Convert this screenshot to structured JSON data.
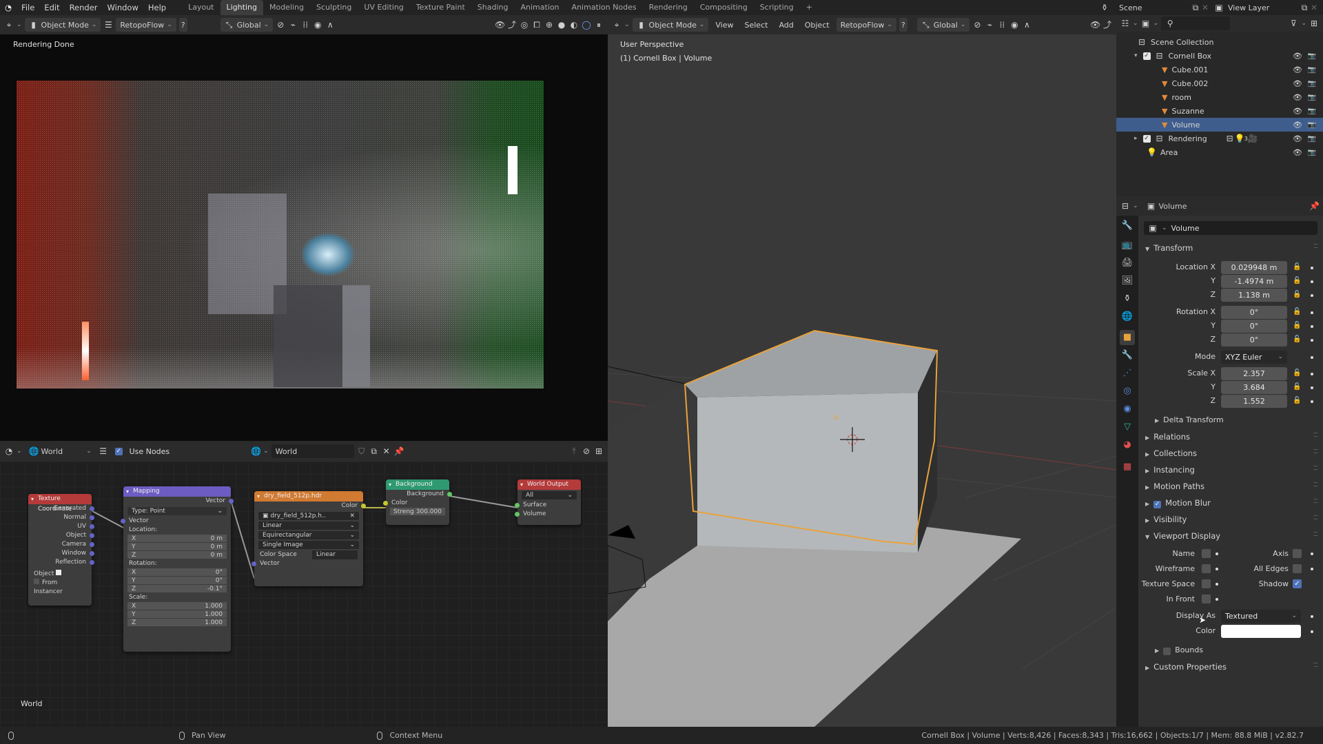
{
  "app": {
    "logo_icon": "blender-logo-icon"
  },
  "menu": [
    "File",
    "Edit",
    "Render",
    "Window",
    "Help"
  ],
  "workspaces": [
    {
      "label": "Layout",
      "active": false
    },
    {
      "label": "Lighting",
      "active": true
    },
    {
      "label": "Modeling",
      "active": false
    },
    {
      "label": "Sculpting",
      "active": false
    },
    {
      "label": "UV Editing",
      "active": false
    },
    {
      "label": "Texture Paint",
      "active": false
    },
    {
      "label": "Shading",
      "active": false
    },
    {
      "label": "Animation",
      "active": false
    },
    {
      "label": "Animation Nodes",
      "active": false
    },
    {
      "label": "Rendering",
      "active": false
    },
    {
      "label": "Compositing",
      "active": false
    },
    {
      "label": "Scripting",
      "active": false
    }
  ],
  "add_workspace": "+",
  "scene": {
    "label": "Scene",
    "view_layer": "View Layer"
  },
  "left_header": {
    "mode": "Object Mode",
    "addon": "RetopoFlow",
    "help": "?",
    "orientation": "Global"
  },
  "render": {
    "status": "Rendering Done"
  },
  "node_editor": {
    "type_icon": "world-icon",
    "data_type": "World",
    "use_nodes_label": "Use Nodes",
    "use_nodes": true,
    "world_name": "World",
    "footer_label": "World",
    "nodes": {
      "tex_coord": {
        "title": "Texture Coordinate",
        "outputs": [
          "Generated",
          "Normal",
          "UV",
          "Object",
          "Camera",
          "Window",
          "Reflection"
        ],
        "object_label": "Object",
        "from_instancer": "From Instancer"
      },
      "mapping": {
        "title": "Mapping",
        "output": "Vector",
        "type_label": "Type:",
        "type_value": "Point",
        "vector_label": "Vector",
        "location_label": "Location:",
        "location": [
          [
            "X",
            "0 m"
          ],
          [
            "Y",
            "0 m"
          ],
          [
            "Z",
            "0 m"
          ]
        ],
        "rotation_label": "Rotation:",
        "rotation": [
          [
            "X",
            "0°"
          ],
          [
            "Y",
            "0°"
          ],
          [
            "Z",
            "-0.1°"
          ]
        ],
        "scale_label": "Scale:",
        "scale": [
          [
            "X",
            "1.000"
          ],
          [
            "Y",
            "1.000"
          ],
          [
            "Z",
            "1.000"
          ]
        ]
      },
      "env_tex": {
        "title": "dry_field_512p.hdr",
        "output": "Color",
        "image": "dry_field_512p.h..",
        "interpolation": "Linear",
        "projection": "Equirectangular",
        "source": "Single Image",
        "color_space_label": "Color Space",
        "color_space": "Linear",
        "input": "Vector"
      },
      "background": {
        "title": "Background",
        "output": "Background",
        "color_label": "Color",
        "strength_label": "Streng",
        "strength": "300.000"
      },
      "world_output": {
        "title": "World Output",
        "target": "All",
        "inputs": [
          "Surface",
          "Volume"
        ]
      }
    }
  },
  "viewport": {
    "mode": "Object Mode",
    "menus": [
      "View",
      "Select",
      "Add",
      "Object"
    ],
    "addon": "RetopoFlow",
    "help": "?",
    "orientation": "Global",
    "perspective": "User Perspective",
    "context": "(1) Cornell Box | Volume"
  },
  "outliner": {
    "search_placeholder": "",
    "root": "Scene Collection",
    "items": [
      {
        "name": "Cornell Box",
        "type": "collection",
        "depth": 1,
        "checked": true,
        "expanded": true
      },
      {
        "name": "Cube.001",
        "type": "mesh",
        "depth": 2
      },
      {
        "name": "Cube.002",
        "type": "mesh",
        "depth": 2
      },
      {
        "name": "room",
        "type": "mesh",
        "depth": 2
      },
      {
        "name": "Suzanne",
        "type": "mesh",
        "depth": 2
      },
      {
        "name": "Volume",
        "type": "mesh",
        "depth": 2,
        "selected": true
      },
      {
        "name": "Rendering",
        "type": "collection",
        "depth": 1,
        "checked": true,
        "expanded": false,
        "badge": "3"
      },
      {
        "name": "Area",
        "type": "light",
        "depth": 1
      }
    ]
  },
  "properties": {
    "header_object": "Volume",
    "object_name": "Volume",
    "transform": {
      "title": "Transform",
      "location_label": "Location X",
      "location": [
        "0.029948 m",
        "-1.4974 m",
        "1.138 m"
      ],
      "rotation_label": "Rotation X",
      "rotation": [
        "0°",
        "0°",
        "0°"
      ],
      "mode_label": "Mode",
      "mode": "XYZ Euler",
      "scale_label": "Scale X",
      "scale": [
        "2.357",
        "3.684",
        "1.552"
      ],
      "axis_y": "Y",
      "axis_z": "Z"
    },
    "delta_transform": "Delta Transform",
    "sections": [
      "Relations",
      "Collections",
      "Instancing",
      "Motion Paths",
      "Motion Blur",
      "Visibility"
    ],
    "motion_blur_enabled": true,
    "viewport_display": {
      "title": "Viewport Display",
      "name_label": "Name",
      "name": false,
      "axis_label": "Axis",
      "axis": false,
      "wireframe_label": "Wireframe",
      "wireframe": false,
      "all_edges_label": "All Edges",
      "all_edges": false,
      "texture_space_label": "Texture Space",
      "texture_space": false,
      "shadow_label": "Shadow",
      "shadow": true,
      "in_front_label": "In Front",
      "in_front": false,
      "display_as_label": "Display As",
      "display_as": "Textured",
      "color_label": "Color",
      "color": "#ffffff",
      "bounds_label": "Bounds",
      "bounds": false
    },
    "custom_properties": "Custom Properties"
  },
  "statusbar": {
    "left_hint": "",
    "middle_hint": "Pan View",
    "right_hint": "Context Menu",
    "stats": "Cornell Box | Volume | Verts:8,426 | Faces:8,343 | Tris:16,662 | Objects:1/7 | Mem: 88.8 MiB | v2.82.7"
  },
  "colors": {
    "accent": "#4f72b8",
    "selection": "#3f5d8c",
    "active_outline": "#e8a23c"
  }
}
